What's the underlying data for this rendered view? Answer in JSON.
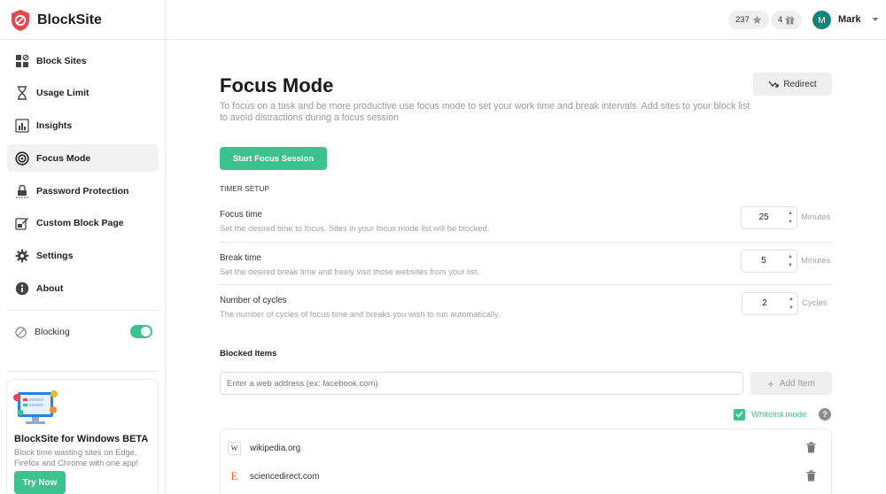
{
  "app": {
    "name": "BlockSite"
  },
  "sidebar": {
    "items": [
      {
        "label": "Block Sites",
        "icon": "grid-block-icon",
        "active": false
      },
      {
        "label": "Usage Limit",
        "icon": "hourglass-icon",
        "active": false
      },
      {
        "label": "Insights",
        "icon": "bar-chart-icon",
        "active": false
      },
      {
        "label": "Focus Mode",
        "icon": "target-icon",
        "active": true
      },
      {
        "label": "Password Protection",
        "icon": "lock-icon",
        "active": false
      },
      {
        "label": "Custom Block Page",
        "icon": "edit-page-icon",
        "active": false
      },
      {
        "label": "Settings",
        "icon": "gear-icon",
        "active": false
      },
      {
        "label": "About",
        "icon": "info-icon",
        "active": false
      }
    ],
    "blocking": {
      "label": "Blocking",
      "enabled": true
    },
    "promo": {
      "title": "BlockSite for Windows BETA",
      "description": "Block time wasting sites on Edge, Firefox and Chrome with one app!",
      "button": "Try Now"
    }
  },
  "topbar": {
    "stars": "237",
    "gifts": "4",
    "user_initial": "M",
    "user_name": "Mark"
  },
  "main": {
    "title": "Focus Mode",
    "description": "To focus on a task and be more productive use focus mode to set your work time and break intervals. Add sites to your block list to avoid distractions during a focus session",
    "redirect_label": "Redirect",
    "start_label": "Start Focus Session",
    "timer_heading": "TIMER SETUP",
    "timer": [
      {
        "label": "Focus time",
        "description": "Set the desired time to focus. Sites in your focus mode list will be blocked.",
        "value": "25",
        "unit": "Minutes"
      },
      {
        "label": "Break time",
        "description": "Set the desired break time and freely visit those websites from your list.",
        "value": "5",
        "unit": "Minutes"
      },
      {
        "label": "Number of cycles",
        "description": "The number of cycles of focus time and breaks you wish to run automatically.",
        "value": "2",
        "unit": "Cycles"
      }
    ],
    "blocked": {
      "heading": "Blocked Items",
      "input_placeholder": "Enter a web address (ex: facebook.com)",
      "add_label": "Add Item",
      "whitelist_label": "Whitelist mode",
      "whitelist_checked": true,
      "items": [
        {
          "domain": "wikipedia.org",
          "favicon": "W"
        },
        {
          "domain": "sciencedirect.com",
          "favicon": "E"
        }
      ]
    }
  },
  "colors": {
    "accent": "#3cc28f",
    "logo": "#e8474c",
    "avatar": "#14857a"
  }
}
